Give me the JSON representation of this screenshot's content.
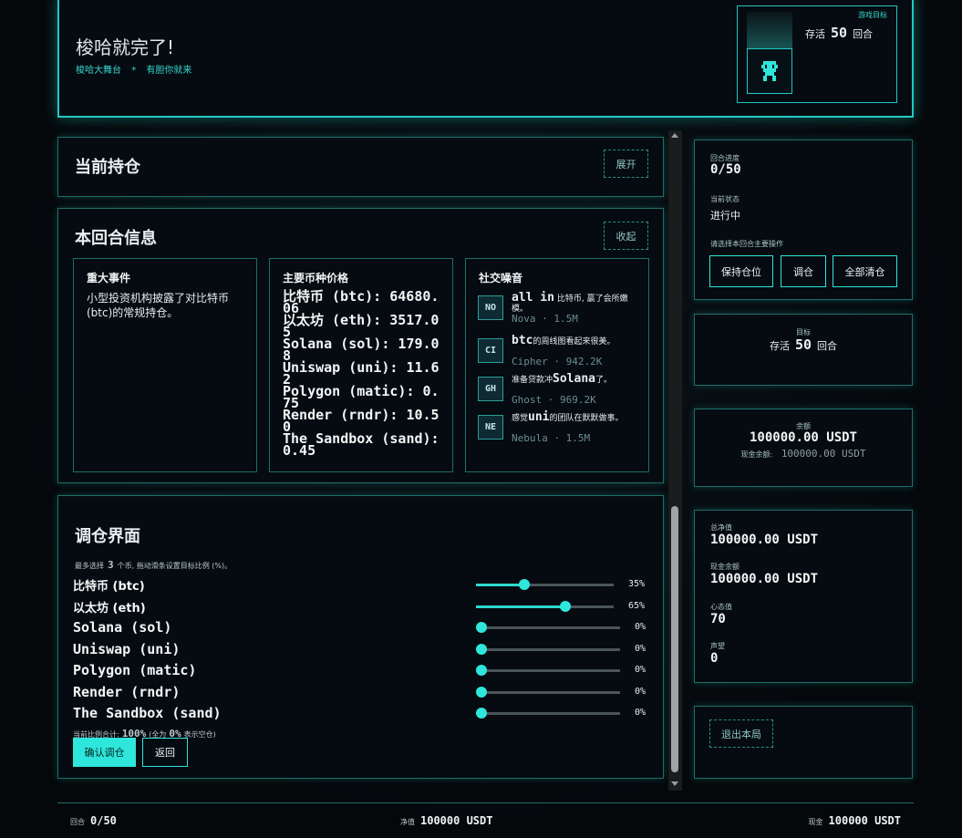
{
  "header": {
    "title": "梭哈就完了!",
    "subtitle_left": "梭哈大舞台",
    "subtitle_sep": "*",
    "subtitle_right": "有胆你就来",
    "goal": {
      "label": "游戏目标",
      "prefix": "存活",
      "value": "50",
      "suffix": "回合"
    }
  },
  "positions": {
    "title": "当前持仓",
    "toggle_label": "展开"
  },
  "round_info": {
    "title": "本回合信息",
    "toggle_label": "收起",
    "event": {
      "title": "重大事件",
      "text": "小型投资机构披露了对比特币(btc)的常规持仓。"
    },
    "prices": {
      "title": "主要币种价格",
      "items": [
        "比特币 (btc): 64680.06",
        "以太坊 (eth): 3517.05",
        "Solana (sol): 179.08",
        "Uniswap (uni): 11.62",
        "Polygon (matic): 0.75",
        "Render (rndr): 10.50",
        "The Sandbox (sand): 0.45"
      ]
    },
    "social": {
      "title": "社交噪音",
      "items": [
        {
          "tag": "NO",
          "head": "all in",
          "body": "比特币, 赢了会所嫩模。",
          "meta": "Nova · 1.5M"
        },
        {
          "tag": "CI",
          "head": "btc",
          "body": "的周线图看起来很美。",
          "meta": "Cipher · 942.2K"
        },
        {
          "tag": "GH",
          "head": "Solana",
          "body": "准备贷款冲",
          "tail": "了。",
          "meta": "Ghost · 969.2K"
        },
        {
          "tag": "NE",
          "head": "uni",
          "body": "感觉",
          "tail": "的团队在默默做事。",
          "meta": "Nebula · 1.5M"
        }
      ]
    }
  },
  "rebalance": {
    "title": "调仓界面",
    "hint_prefix": "最多选择",
    "hint_num": "3",
    "hint_suffix": "个币, 拖动滑条设置目标比例 (%)。",
    "rows": [
      {
        "label": "比特币 (btc)",
        "value": 35,
        "pct": "35%"
      },
      {
        "label": "以太坊 (eth)",
        "value": 65,
        "pct": "65%"
      },
      {
        "label": "Solana (sol)",
        "value": 0,
        "pct": "0%"
      },
      {
        "label": "Uniswap (uni)",
        "value": 0,
        "pct": "0%"
      },
      {
        "label": "Polygon (matic)",
        "value": 0,
        "pct": "0%"
      },
      {
        "label": "Render (rndr)",
        "value": 0,
        "pct": "0%"
      },
      {
        "label": "The Sandbox (sand)",
        "value": 0,
        "pct": "0%"
      }
    ],
    "total_prefix": "当前比例合计:",
    "total_value": "100%",
    "total_mid": "(全为",
    "total_zero": "0%",
    "total_suffix": "表示空仓)",
    "confirm_label": "确认调仓",
    "back_label": "返回"
  },
  "sidebar": {
    "progress_label": "回合进度",
    "progress_value": "0/50",
    "status_label": "当前状态",
    "status_value": "进行中",
    "action_label": "请选择本回合主要操作",
    "actions": [
      "保持仓位",
      "调仓",
      "全部清仓"
    ],
    "goal_label": "目标",
    "goal_prefix": "存活",
    "goal_value": "50",
    "goal_suffix": "回合",
    "balance_label": "余额",
    "balance_value": "100000.00 USDT",
    "cash_prefix": "现金余额:",
    "cash_value": "100000.00 USDT",
    "net_label": "总净值",
    "net_value": "100000.00 USDT",
    "cash2_label": "现金余额",
    "cash2_value": "100000.00 USDT",
    "mind_label": "心态值",
    "mind_value": "70",
    "fame_label": "声望",
    "fame_value": "0",
    "exit_label": "退出本局"
  },
  "footer": {
    "round_label": "回合",
    "round_value": "0/50",
    "net_label": "净值",
    "net_value": "100000 USDT",
    "cash_label": "现金",
    "cash_value": "100000 USDT"
  },
  "colors": {
    "accent": "#2ee6dc",
    "border": "#1d6f6a",
    "bg": "#05080b"
  },
  "icons": {
    "avatar": "pixel-robot-icon"
  }
}
